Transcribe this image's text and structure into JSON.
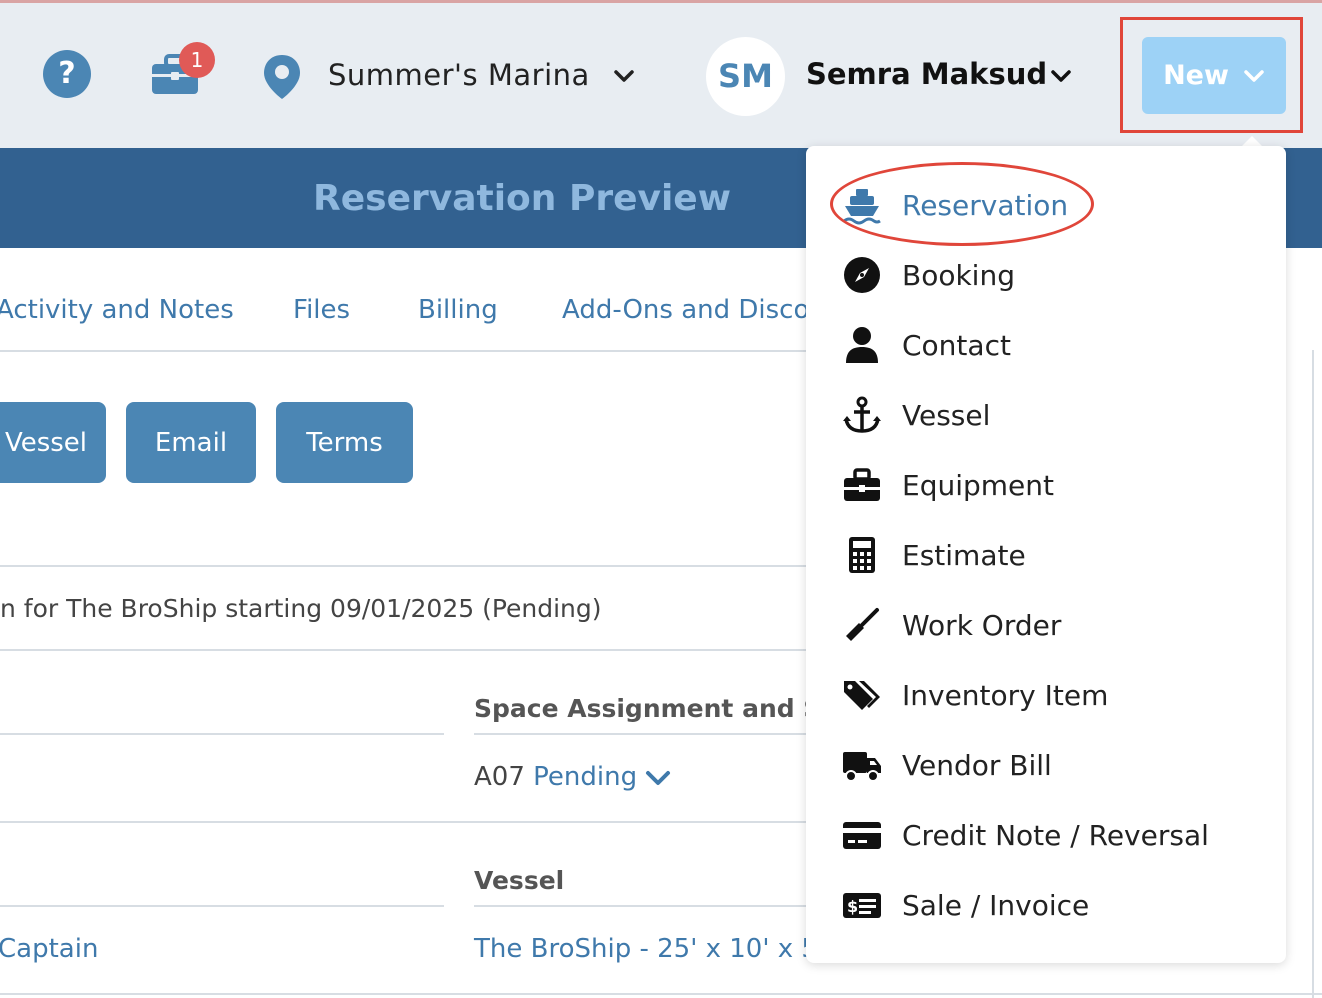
{
  "topbar": {
    "help_icon": "?",
    "notification_count": "1",
    "marina_name": "Summer's Marina",
    "user_initials": "SM",
    "user_name": "Semra Maksud",
    "new_button_label": "New"
  },
  "banner": {
    "title": "Reservation Preview"
  },
  "tabs": [
    "Activity and Notes",
    "Files",
    "Billing",
    "Add-Ons and Disco"
  ],
  "actions": [
    "Vessel",
    "Email",
    "Terms"
  ],
  "details": {
    "summary": "n for The BroShip starting 09/01/2025 (Pending)",
    "space_heading": "Space Assignment and Sta",
    "space_code": "A07",
    "space_status": "Pending",
    "vessel_heading": "Vessel",
    "contact_role": "Captain",
    "vessel_link": "The BroShip - 25' x 10' x 5"
  },
  "new_menu": {
    "items": [
      {
        "label": "Reservation",
        "icon": "boat-icon"
      },
      {
        "label": "Booking",
        "icon": "compass-icon"
      },
      {
        "label": "Contact",
        "icon": "user-icon"
      },
      {
        "label": "Vessel",
        "icon": "anchor-icon"
      },
      {
        "label": "Equipment",
        "icon": "toolbox-icon"
      },
      {
        "label": "Estimate",
        "icon": "calculator-icon"
      },
      {
        "label": "Work Order",
        "icon": "screwdriver-icon"
      },
      {
        "label": "Inventory Item",
        "icon": "tags-icon"
      },
      {
        "label": "Vendor Bill",
        "icon": "truck-icon"
      },
      {
        "label": "Credit Note / Reversal",
        "icon": "credit-card-icon"
      },
      {
        "label": "Sale / Invoice",
        "icon": "money-bill-icon"
      }
    ]
  },
  "colors": {
    "accent": "#3f79ab",
    "banner": "#326190",
    "new_button": "#9dd2f6",
    "highlight": "#e0463a"
  }
}
